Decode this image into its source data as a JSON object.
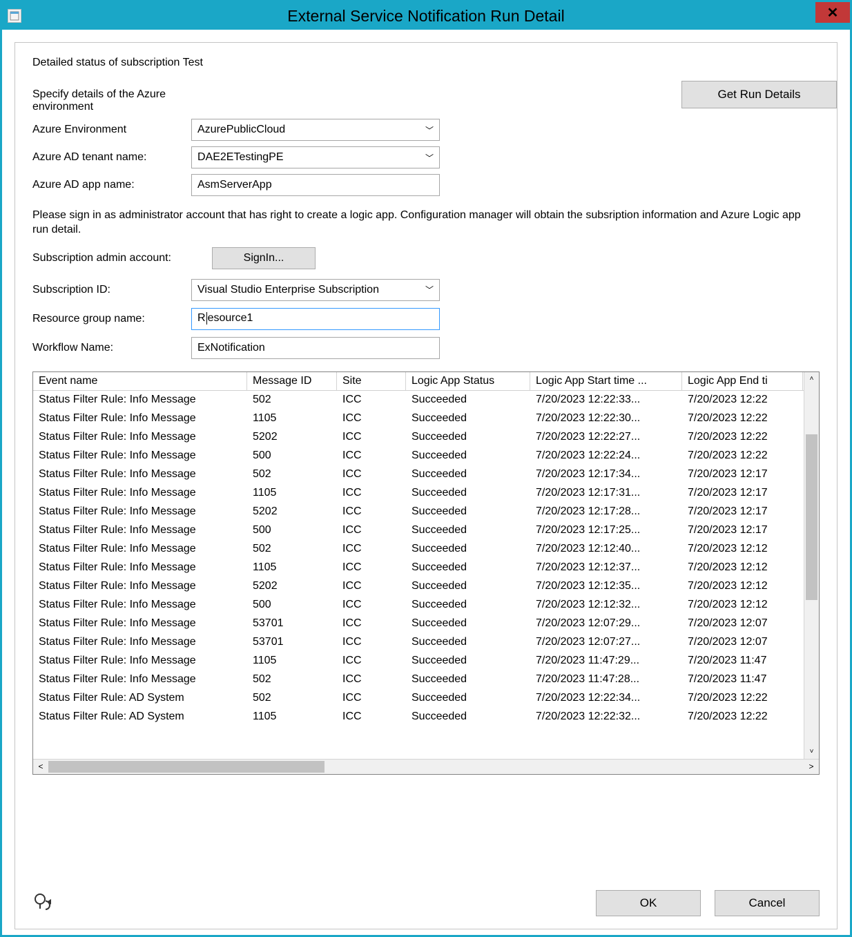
{
  "titlebar": {
    "title": "External Service Notification Run Detail",
    "close": "✕"
  },
  "header": {
    "detailed": "Detailed status of subscription Test",
    "specify": "Specify details of the Azure environment",
    "getRunDetails": "Get Run Details"
  },
  "form": {
    "azureEnv_label": "Azure Environment",
    "azureEnv_value": "AzurePublicCloud",
    "tenant_label": "Azure AD tenant name:",
    "tenant_value": "DAE2ETestingPE",
    "app_label": "Azure AD app name:",
    "app_value": "AsmServerApp",
    "instruction": "Please sign in as administrator account that has right to create a logic app. Configuration manager will obtain the subsription information and Azure Logic app run detail.",
    "adminAccount_label": "Subscription admin account:",
    "signIn": "SignIn...",
    "subId_label": "Subscription ID:",
    "subId_value": "Visual Studio Enterprise Subscription",
    "rg_label": "Resource group name:",
    "rg_pre": "R",
    "rg_post": "esource1",
    "workflow_label": "Workflow Name:",
    "workflow_value": "ExNotification"
  },
  "grid": {
    "columns": [
      "Event name",
      "Message ID",
      "Site",
      "Logic App Status",
      "Logic App Start time ...",
      "Logic App End ti"
    ],
    "rows": [
      {
        "event": "Status Filter Rule: Info Message",
        "msg": "502",
        "site": "ICC",
        "status": "Succeeded",
        "start": "7/20/2023 12:22:33...",
        "end": "7/20/2023 12:22"
      },
      {
        "event": "Status Filter Rule: Info Message",
        "msg": "1105",
        "site": "ICC",
        "status": "Succeeded",
        "start": "7/20/2023 12:22:30...",
        "end": "7/20/2023 12:22"
      },
      {
        "event": "Status Filter Rule: Info Message",
        "msg": "5202",
        "site": "ICC",
        "status": "Succeeded",
        "start": "7/20/2023 12:22:27...",
        "end": "7/20/2023 12:22"
      },
      {
        "event": "Status Filter Rule: Info Message",
        "msg": "500",
        "site": "ICC",
        "status": "Succeeded",
        "start": "7/20/2023 12:22:24...",
        "end": "7/20/2023 12:22"
      },
      {
        "event": "Status Filter Rule: Info Message",
        "msg": "502",
        "site": "ICC",
        "status": "Succeeded",
        "start": "7/20/2023 12:17:34...",
        "end": "7/20/2023 12:17"
      },
      {
        "event": "Status Filter Rule: Info Message",
        "msg": "1105",
        "site": "ICC",
        "status": "Succeeded",
        "start": "7/20/2023 12:17:31...",
        "end": "7/20/2023 12:17"
      },
      {
        "event": "Status Filter Rule: Info Message",
        "msg": "5202",
        "site": "ICC",
        "status": "Succeeded",
        "start": "7/20/2023 12:17:28...",
        "end": "7/20/2023 12:17"
      },
      {
        "event": "Status Filter Rule: Info Message",
        "msg": "500",
        "site": "ICC",
        "status": "Succeeded",
        "start": "7/20/2023 12:17:25...",
        "end": "7/20/2023 12:17"
      },
      {
        "event": "Status Filter Rule: Info Message",
        "msg": "502",
        "site": "ICC",
        "status": "Succeeded",
        "start": "7/20/2023 12:12:40...",
        "end": "7/20/2023 12:12"
      },
      {
        "event": "Status Filter Rule: Info Message",
        "msg": "1105",
        "site": "ICC",
        "status": "Succeeded",
        "start": "7/20/2023 12:12:37...",
        "end": "7/20/2023 12:12"
      },
      {
        "event": "Status Filter Rule: Info Message",
        "msg": "5202",
        "site": "ICC",
        "status": "Succeeded",
        "start": "7/20/2023 12:12:35...",
        "end": "7/20/2023 12:12"
      },
      {
        "event": "Status Filter Rule: Info Message",
        "msg": "500",
        "site": "ICC",
        "status": "Succeeded",
        "start": "7/20/2023 12:12:32...",
        "end": "7/20/2023 12:12"
      },
      {
        "event": "Status Filter Rule: Info Message",
        "msg": "53701",
        "site": "ICC",
        "status": "Succeeded",
        "start": "7/20/2023 12:07:29...",
        "end": "7/20/2023 12:07"
      },
      {
        "event": "Status Filter Rule: Info Message",
        "msg": "53701",
        "site": "ICC",
        "status": "Succeeded",
        "start": "7/20/2023 12:07:27...",
        "end": "7/20/2023 12:07"
      },
      {
        "event": "Status Filter Rule: Info Message",
        "msg": "1105",
        "site": "ICC",
        "status": "Succeeded",
        "start": "7/20/2023 11:47:29...",
        "end": "7/20/2023 11:47"
      },
      {
        "event": "Status Filter Rule: Info Message",
        "msg": "502",
        "site": "ICC",
        "status": "Succeeded",
        "start": "7/20/2023 11:47:28...",
        "end": "7/20/2023 11:47"
      },
      {
        "event": "Status Filter Rule: AD System",
        "msg": "502",
        "site": "ICC",
        "status": "Succeeded",
        "start": "7/20/2023 12:22:34...",
        "end": "7/20/2023 12:22"
      },
      {
        "event": "Status Filter Rule: AD System",
        "msg": "1105",
        "site": "ICC",
        "status": "Succeeded",
        "start": "7/20/2023 12:22:32...",
        "end": "7/20/2023 12:22"
      }
    ]
  },
  "footer": {
    "ok": "OK",
    "cancel": "Cancel"
  }
}
